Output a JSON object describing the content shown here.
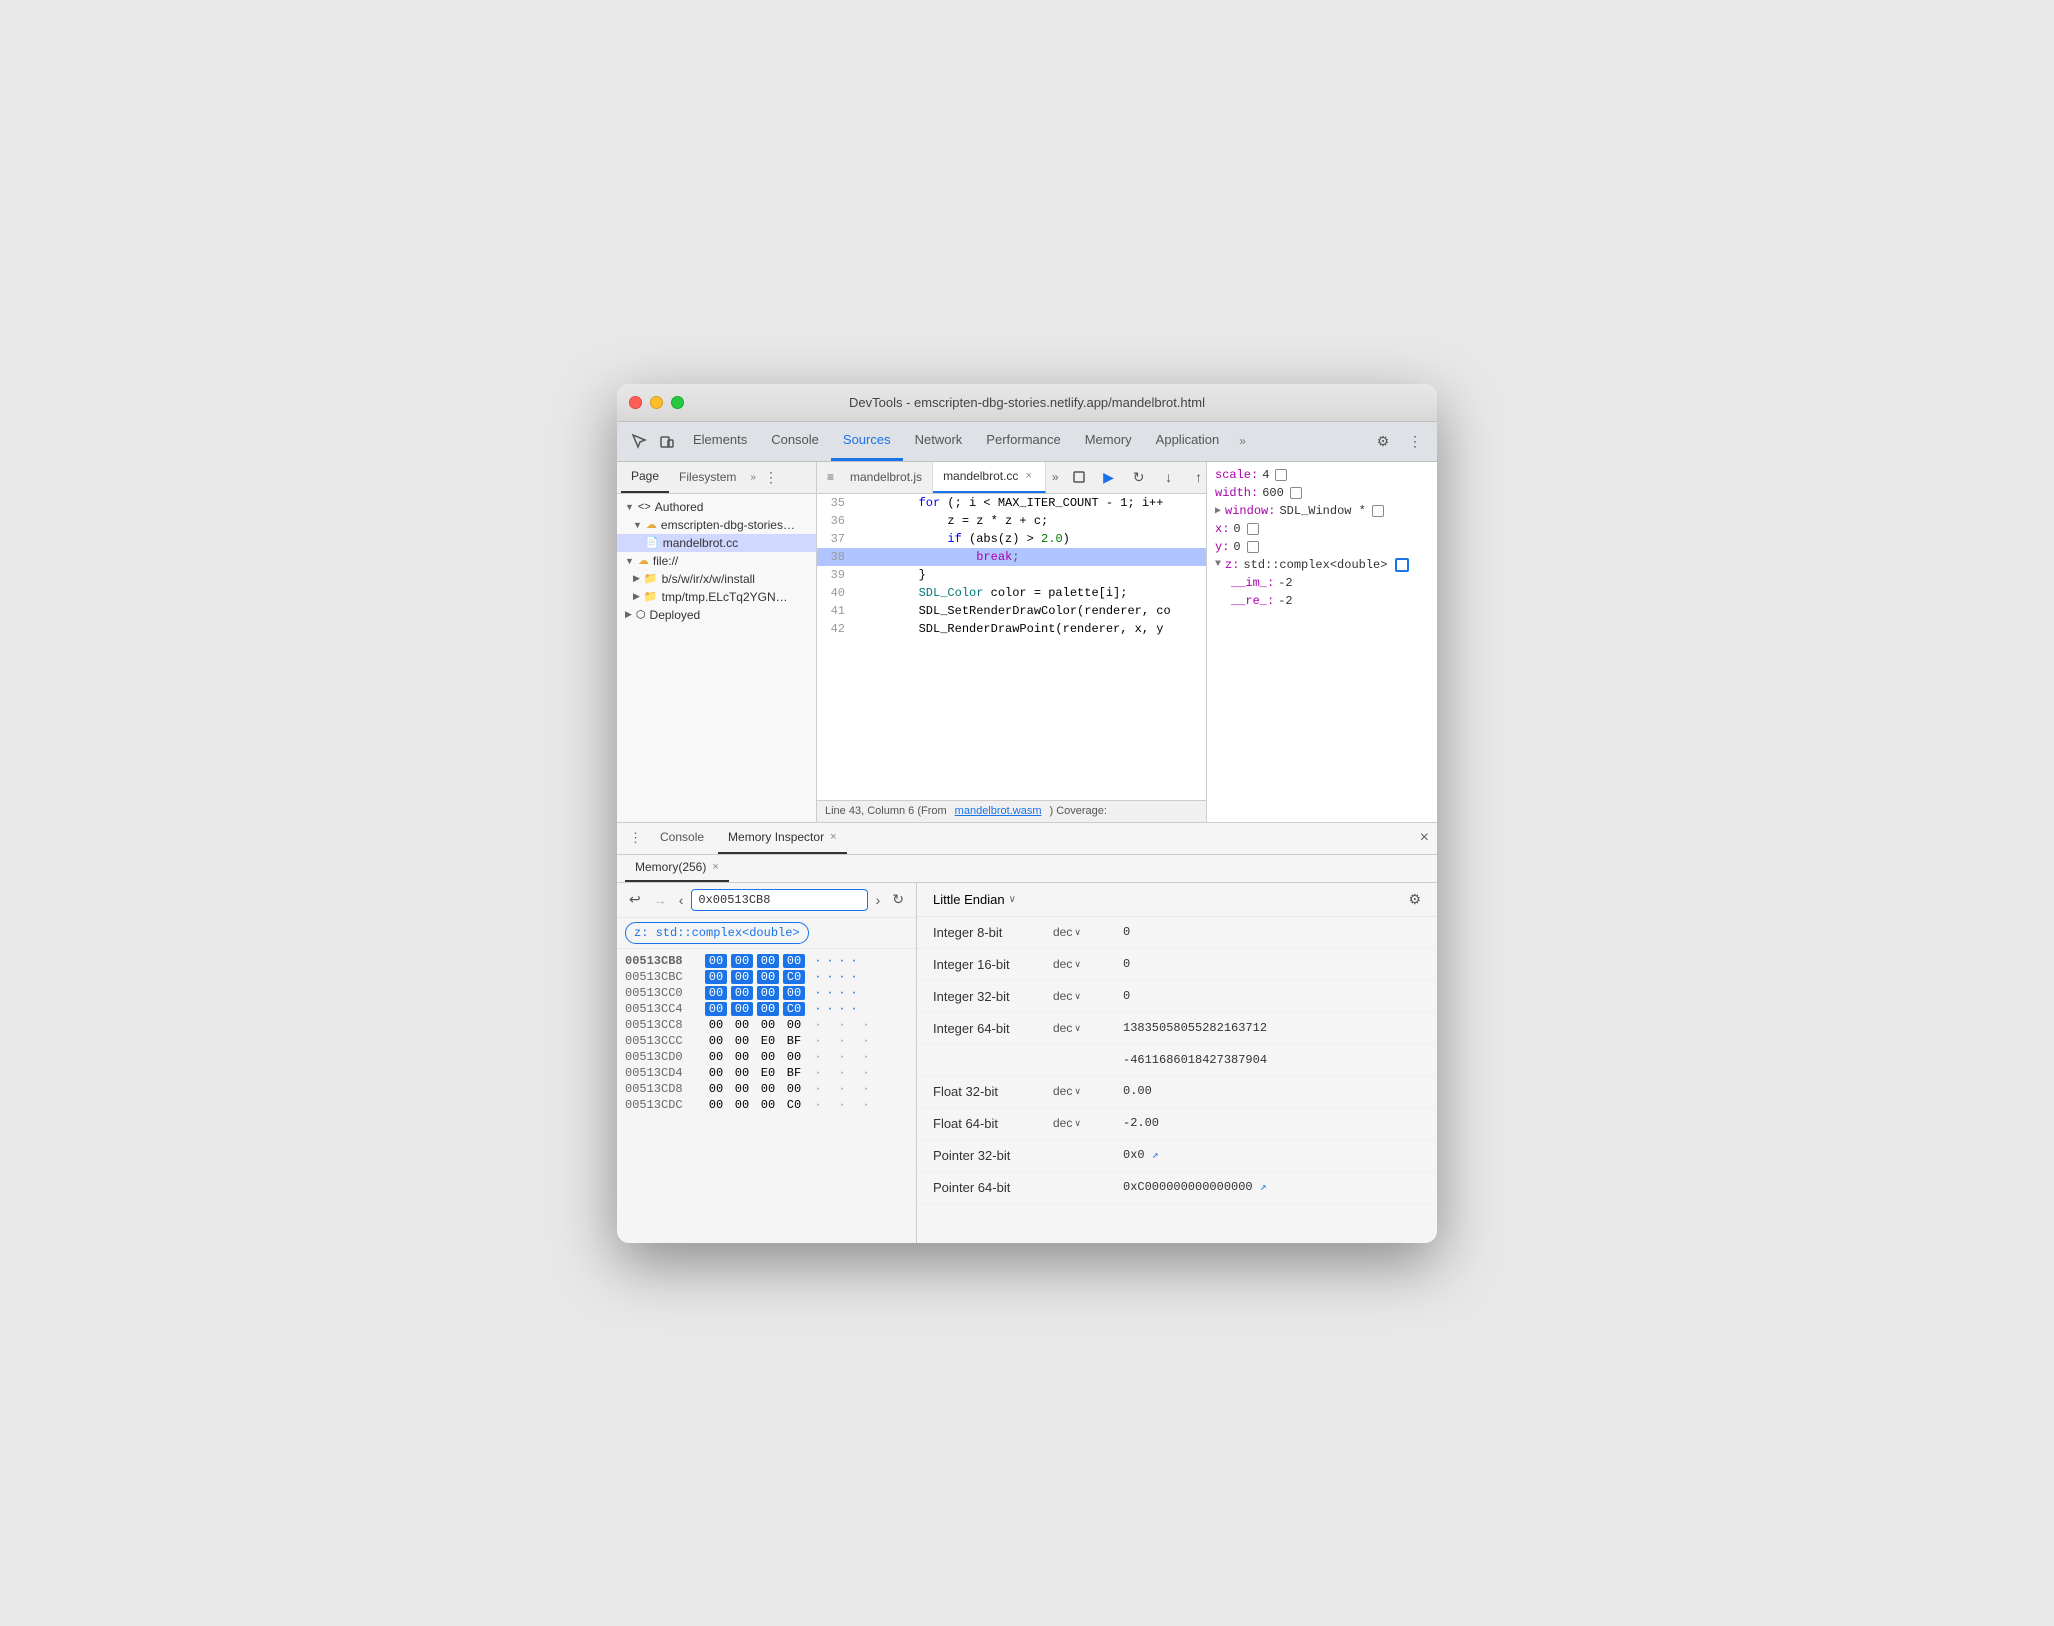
{
  "window": {
    "title": "DevTools - emscripten-dbg-stories.netlify.app/mandelbrot.html",
    "traffic_lights": [
      "close",
      "minimize",
      "maximize"
    ]
  },
  "devtools_tabs": {
    "items": [
      "Elements",
      "Console",
      "Sources",
      "Network",
      "Performance",
      "Memory",
      "Application"
    ],
    "active": "Sources",
    "more_label": "»",
    "icons": {
      "settings": "⚙",
      "more": "⋮"
    }
  },
  "source_panel": {
    "left_tabs": {
      "page": "Page",
      "filesystem": "Filesystem",
      "more": "»",
      "active": "Page"
    },
    "file_tree": {
      "authored": {
        "label": "Authored",
        "children": {
          "emscripten": {
            "label": "emscripten-dbg-stories…",
            "children": {
              "mandelbrot_cc": "mandelbrot.cc"
            }
          }
        }
      },
      "file": {
        "label": "file://",
        "children": {
          "install": "b/s/w/ir/x/w/install",
          "tmp": "tmp/tmp.ELcTq2YGN…"
        }
      },
      "deployed": {
        "label": "Deployed"
      }
    },
    "editor_tabs": {
      "mandelbrot_js": "mandelbrot.js",
      "mandelbrot_cc": "mandelbrot.cc",
      "active": "mandelbrot.cc",
      "more": "»",
      "close": "×"
    },
    "code": {
      "lines": [
        {
          "num": 35,
          "content": "        for (; i < MAX_ITER_COUNT - 1; i++"
        },
        {
          "num": 36,
          "content": "            z = z * z + c;"
        },
        {
          "num": 37,
          "content": "            if (abs(z) > 2.0)"
        },
        {
          "num": 38,
          "content": "                break;",
          "highlighted": true
        },
        {
          "num": 39,
          "content": "        }"
        },
        {
          "num": 40,
          "content": "        SDL_Color color = palette[i];"
        },
        {
          "num": 41,
          "content": "        SDL_SetRenderDrawColor(renderer, co"
        },
        {
          "num": 42,
          "content": "        SDL_RenderDrawPoint(renderer, x, y"
        }
      ]
    },
    "status_bar": {
      "text": "Line 43, Column 6 (From ",
      "link": "mandelbrot.wasm",
      "text2": ") Coverage:"
    }
  },
  "debug_panel": {
    "toolbar_buttons": [
      "resume",
      "step-over",
      "step-into",
      "step-out",
      "deactivate"
    ],
    "values": [
      {
        "label": "scale:",
        "value": "4",
        "memory": true
      },
      {
        "label": "width:",
        "value": "600",
        "memory": true
      },
      {
        "label": "window:",
        "value": "SDL_Window *",
        "expand": true,
        "memory": true
      },
      {
        "label": "x:",
        "value": "0",
        "memory": true
      },
      {
        "label": "y:",
        "value": "0",
        "memory": true
      },
      {
        "label": "z:",
        "value": "std::complex<double>",
        "expand": true,
        "memory": true,
        "memory_highlighted": true
      },
      {
        "label": "__im_:",
        "value": "-2",
        "indent": true
      },
      {
        "label": "__re_:",
        "value": "-2",
        "indent": true
      }
    ]
  },
  "bottom_panel": {
    "tabs": [
      "Console",
      "Memory Inspector"
    ],
    "active": "Memory Inspector",
    "memory_tab_label": "Memory(256)",
    "close_label": "×",
    "navigation": {
      "back": "↩",
      "forward": "→",
      "prev": "‹",
      "address": "0x00513CB8",
      "next": "›",
      "refresh": "↻"
    },
    "variable_label": "z: std::complex<double>",
    "endian": "Little Endian",
    "endian_arrow": "∨",
    "settings_icon": "⚙",
    "hex_rows": [
      {
        "addr": "00513CB8",
        "bytes": [
          "00",
          "00",
          "00",
          "00"
        ],
        "highlighted": [
          true,
          true,
          true,
          true
        ],
        "ascii": [
          "·",
          "·",
          "·",
          "·"
        ]
      },
      {
        "addr": "00513CBC",
        "bytes": [
          "00",
          "00",
          "00",
          "C0"
        ],
        "highlighted": [
          true,
          true,
          true,
          true
        ],
        "ascii": [
          "·",
          "·",
          "·",
          "·"
        ]
      },
      {
        "addr": "00513CC0",
        "bytes": [
          "00",
          "00",
          "00",
          "00"
        ],
        "highlighted": [
          true,
          true,
          true,
          true
        ],
        "ascii": [
          "·",
          "·",
          "·",
          "·"
        ]
      },
      {
        "addr": "00513CC4",
        "bytes": [
          "00",
          "00",
          "00",
          "C0"
        ],
        "highlighted": [
          true,
          true,
          true,
          true
        ],
        "ascii": [
          "·",
          "·",
          "·",
          "·"
        ]
      },
      {
        "addr": "00513CC8",
        "bytes": [
          "00",
          "00",
          "00",
          "00"
        ],
        "highlighted": [
          false,
          false,
          false,
          false
        ],
        "ascii": [
          "·",
          "·",
          "·",
          "·"
        ]
      },
      {
        "addr": "00513CCC",
        "bytes": [
          "00",
          "00",
          "E0",
          "BF"
        ],
        "highlighted": [
          false,
          false,
          false,
          false
        ],
        "ascii": [
          "·",
          "·",
          "·",
          "·"
        ]
      },
      {
        "addr": "00513CD0",
        "bytes": [
          "00",
          "00",
          "00",
          "00"
        ],
        "highlighted": [
          false,
          false,
          false,
          false
        ],
        "ascii": [
          "·",
          "·",
          "·",
          "·"
        ]
      },
      {
        "addr": "00513CD4",
        "bytes": [
          "00",
          "00",
          "E0",
          "BF"
        ],
        "highlighted": [
          false,
          false,
          false,
          false
        ],
        "ascii": [
          "·",
          "·",
          "·",
          "·"
        ]
      },
      {
        "addr": "00513CD8",
        "bytes": [
          "00",
          "00",
          "00",
          "00"
        ],
        "highlighted": [
          false,
          false,
          false,
          false
        ],
        "ascii": [
          "·",
          "·",
          "·",
          "·"
        ]
      },
      {
        "addr": "00513CDC",
        "bytes": [
          "00",
          "00",
          "00",
          "C0"
        ],
        "highlighted": [
          false,
          false,
          false,
          false
        ],
        "ascii": [
          "·",
          "·",
          "·",
          "·"
        ]
      }
    ],
    "memory_values": [
      {
        "type": "Integer 8-bit",
        "format": "dec",
        "value": "0"
      },
      {
        "type": "Integer 16-bit",
        "format": "dec",
        "value": "0"
      },
      {
        "type": "Integer 32-bit",
        "format": "dec",
        "value": "0"
      },
      {
        "type": "Integer 64-bit",
        "format": "dec",
        "value": "13835058055282163712"
      },
      {
        "type": "",
        "format": "",
        "value": "-4611686018427387904"
      },
      {
        "type": "Float 32-bit",
        "format": "dec",
        "value": "0.00"
      },
      {
        "type": "Float 64-bit",
        "format": "dec",
        "value": "-2.00"
      },
      {
        "type": "Pointer 32-bit",
        "format": "",
        "value": "0x0",
        "link": true
      },
      {
        "type": "Pointer 64-bit",
        "format": "",
        "value": "0xC000000000000000",
        "link": true
      }
    ]
  }
}
